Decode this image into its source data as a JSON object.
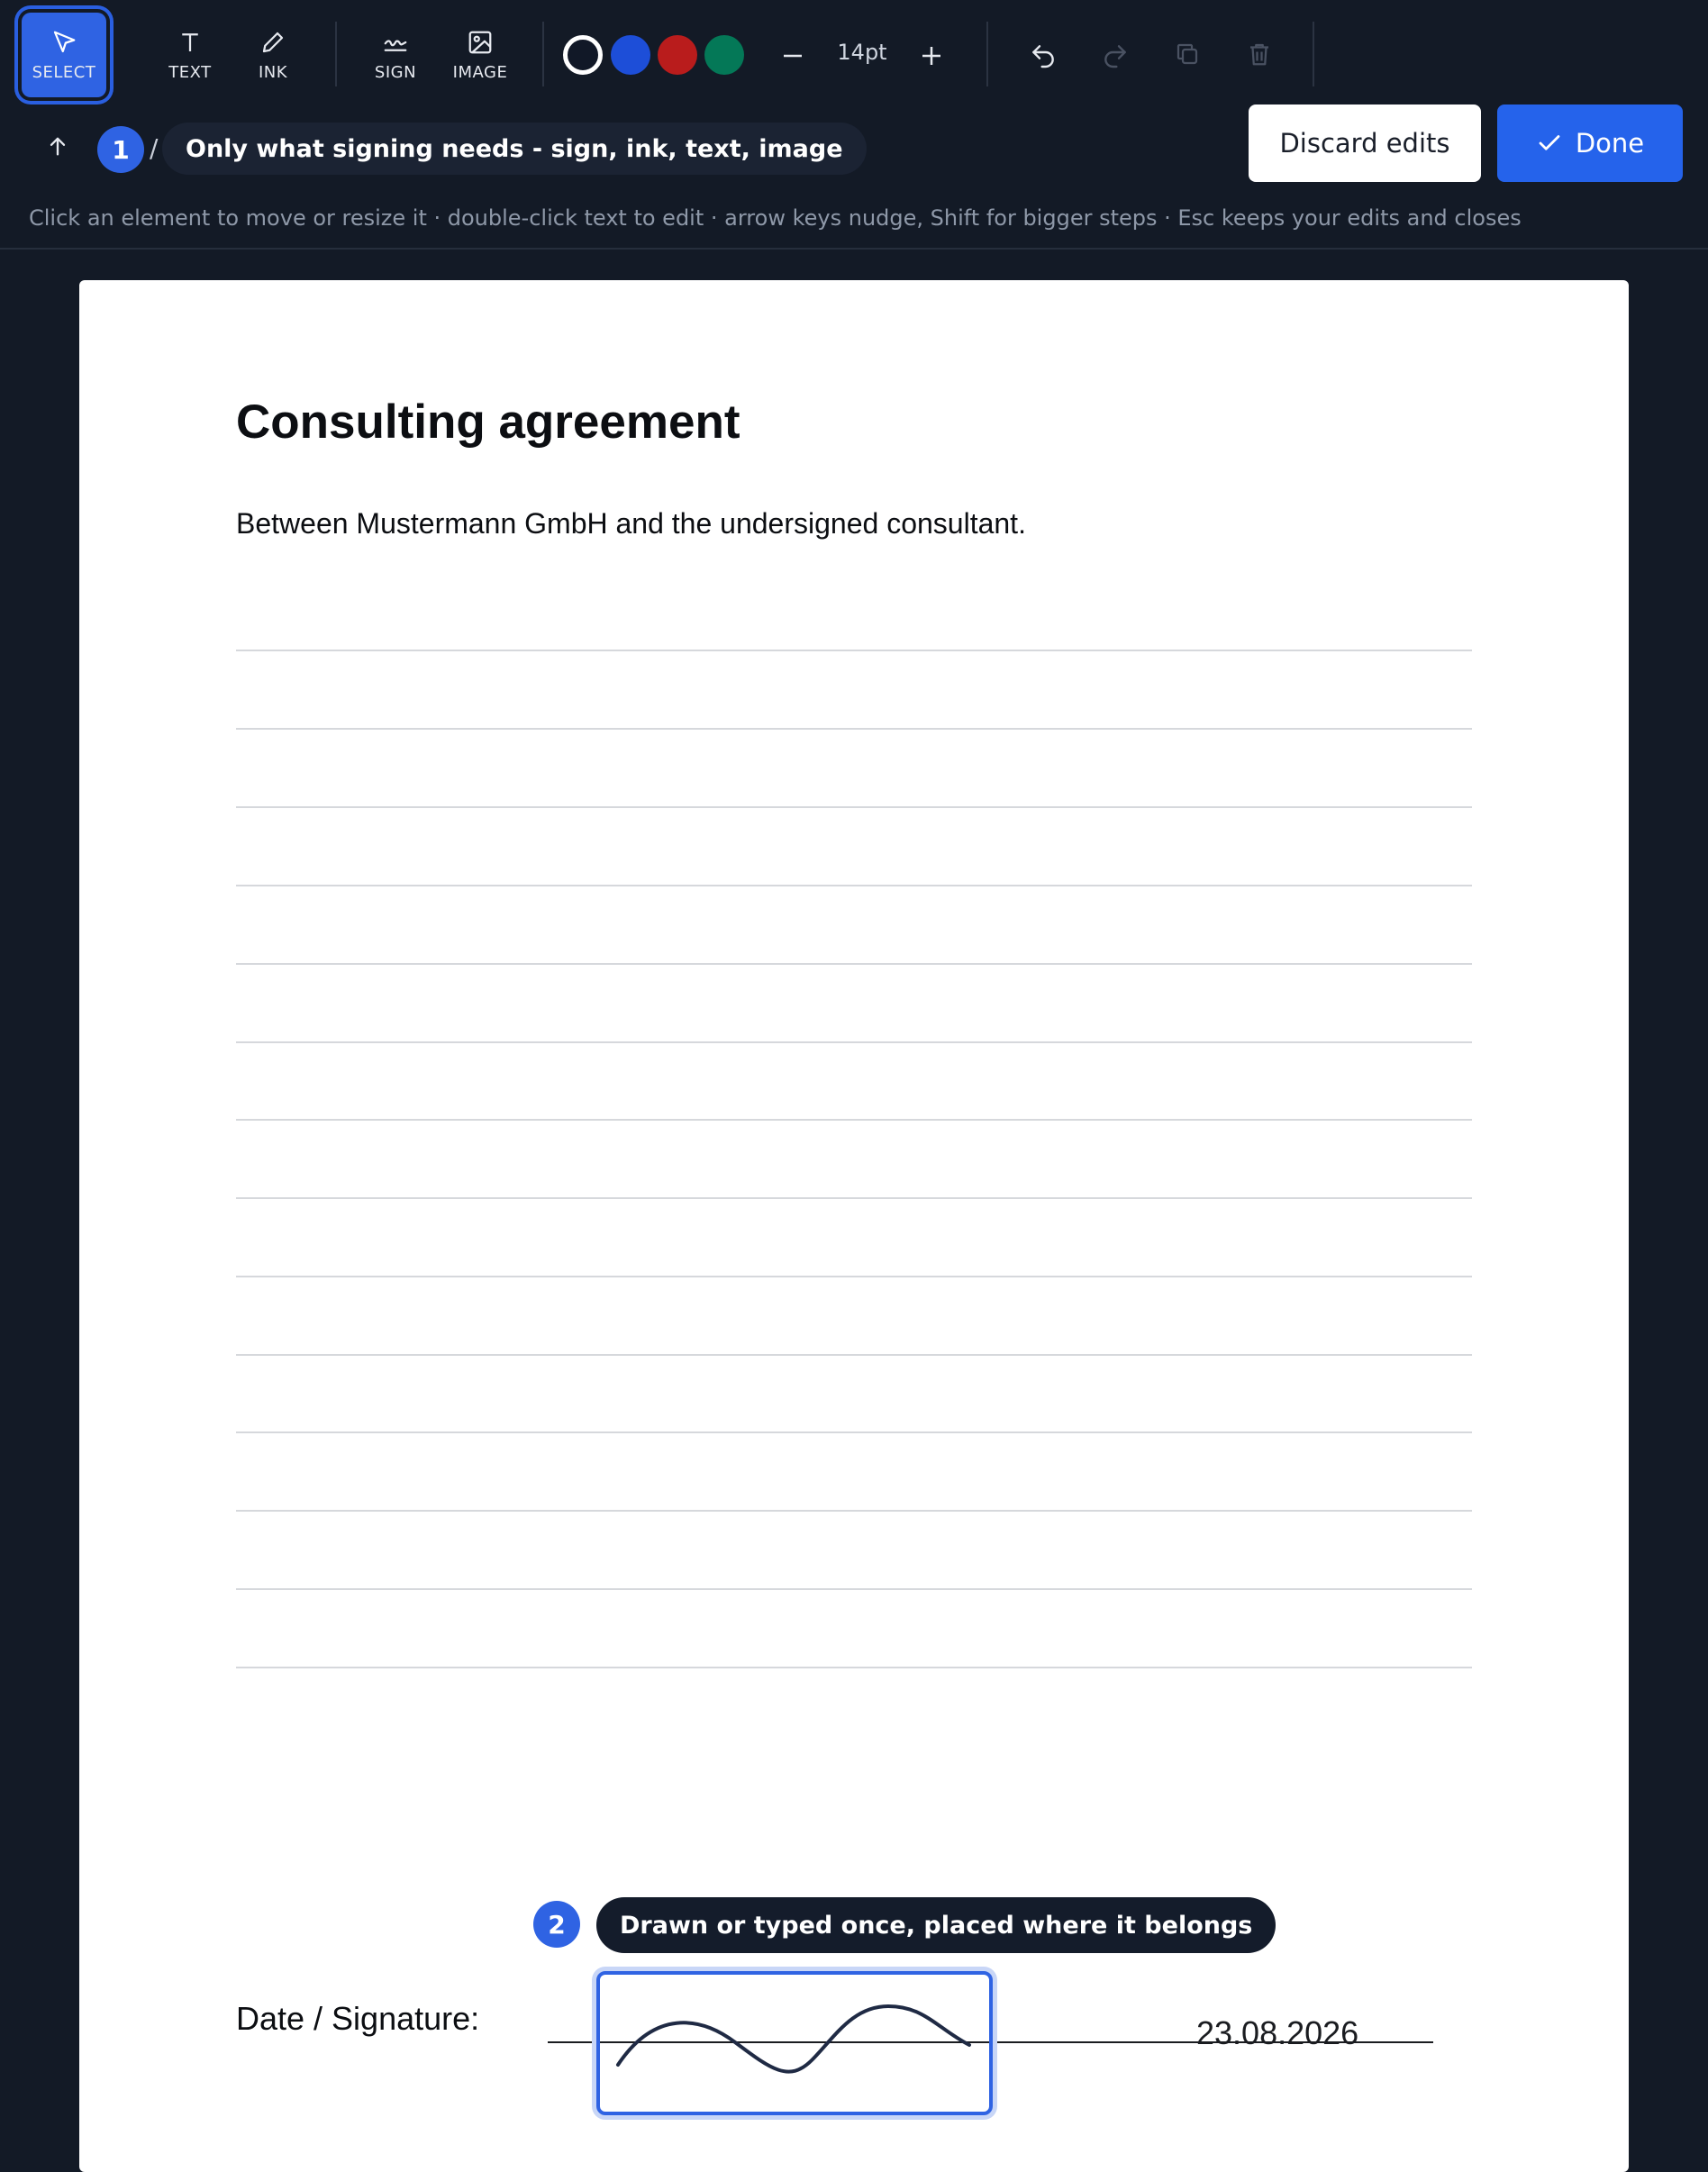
{
  "toolbar": {
    "tools": [
      {
        "id": "select",
        "label": "SELECT",
        "active": true
      },
      {
        "id": "text",
        "label": "TEXT"
      },
      {
        "id": "ink",
        "label": "INK"
      },
      {
        "id": "sign",
        "label": "SIGN"
      },
      {
        "id": "image",
        "label": "IMAGE"
      }
    ],
    "colors": [
      "#111827",
      "#1d4ed8",
      "#b91c1c",
      "#047857"
    ],
    "selected_color": "#111827",
    "font_size": "14pt",
    "icons": [
      "minus-icon",
      "plus-icon",
      "undo-icon",
      "redo-icon",
      "duplicate-icon",
      "trash-icon"
    ]
  },
  "breadcrumb": {
    "step1_number": "1",
    "separator": "/",
    "step1_text": "Only what signing needs - sign, ink, text, image"
  },
  "actions": {
    "discard_label": "Discard edits",
    "done_label": "Done"
  },
  "hint": "Click an element to move or resize it · double-click text to edit · arrow keys nudge, Shift for bigger steps · Esc keeps your edits and closes",
  "document": {
    "title": "Consulting agreement",
    "intro": "Between Mustermann GmbH and the undersigned consultant.",
    "signature_label": "Date / Signature:",
    "date": "23.08.2026"
  },
  "callout2": {
    "number": "2",
    "text": "Drawn or typed once, placed where it belongs"
  },
  "accent": "#2563eb"
}
